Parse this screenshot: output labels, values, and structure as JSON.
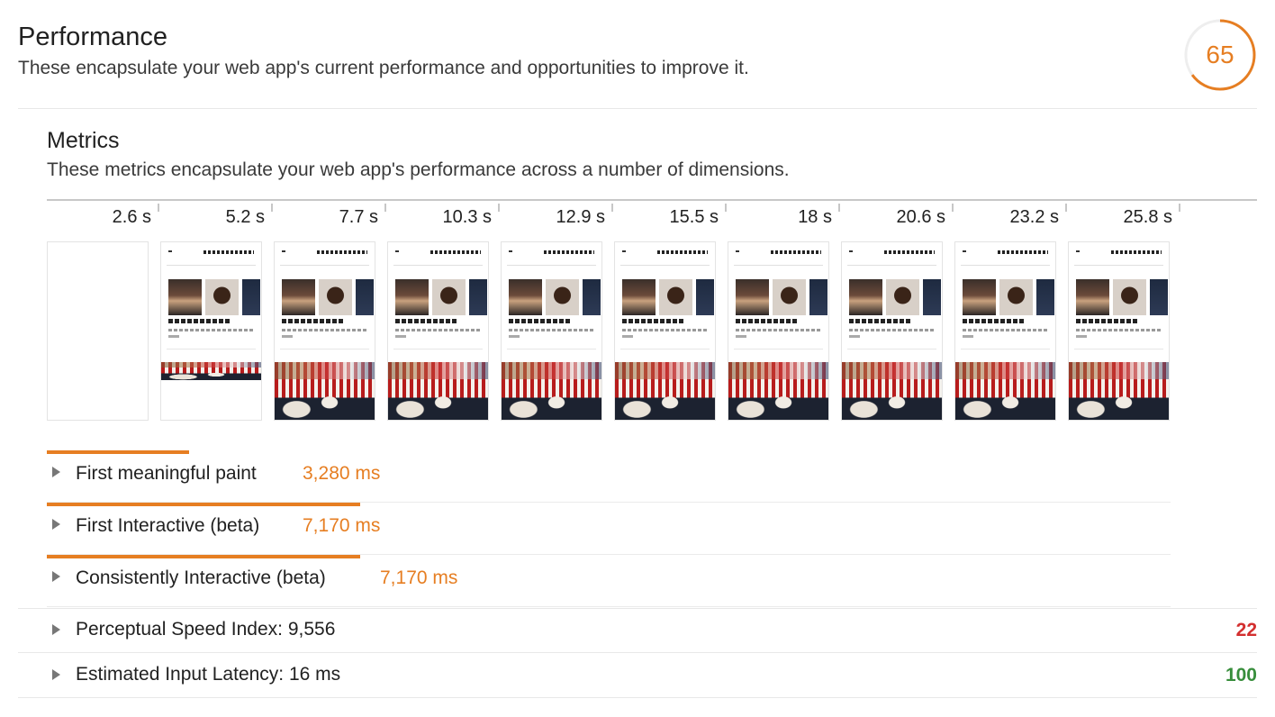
{
  "category": {
    "title": "Performance",
    "description": "These encapsulate your web app's current performance and opportunities to improve it.",
    "score": "65",
    "score_fraction": 0.65,
    "score_color": "#e67e22"
  },
  "metrics_section": {
    "title": "Metrics",
    "description": "These metrics encapsulate your web app's performance across a number of dimensions."
  },
  "filmstrip": {
    "ticks": [
      "2.6 s",
      "5.2 s",
      "7.7 s",
      "10.3 s",
      "12.9 s",
      "15.5 s",
      "18 s",
      "20.6 s",
      "23.2 s",
      "25.8 s"
    ],
    "frames": [
      "blank",
      "partial",
      "full",
      "full",
      "full",
      "full",
      "full",
      "full",
      "full",
      "full"
    ]
  },
  "metrics": [
    {
      "name": "First meaningful paint",
      "value": "3,280 ms",
      "bar_fraction": 0.127
    },
    {
      "name": "First Interactive (beta)",
      "value": "7,170 ms",
      "bar_fraction": 0.279
    },
    {
      "name": "Consistently Interactive (beta)",
      "value": "7,170 ms",
      "bar_fraction": 0.279
    }
  ],
  "audits": [
    {
      "name": "Perceptual Speed Index: 9,556",
      "score": "22",
      "color": "#d32f2f"
    },
    {
      "name": "Estimated Input Latency: 16 ms",
      "score": "100",
      "color": "#388e3c"
    }
  ],
  "colors": {
    "accent": "#e67e22",
    "fail": "#d32f2f",
    "pass": "#388e3c"
  }
}
